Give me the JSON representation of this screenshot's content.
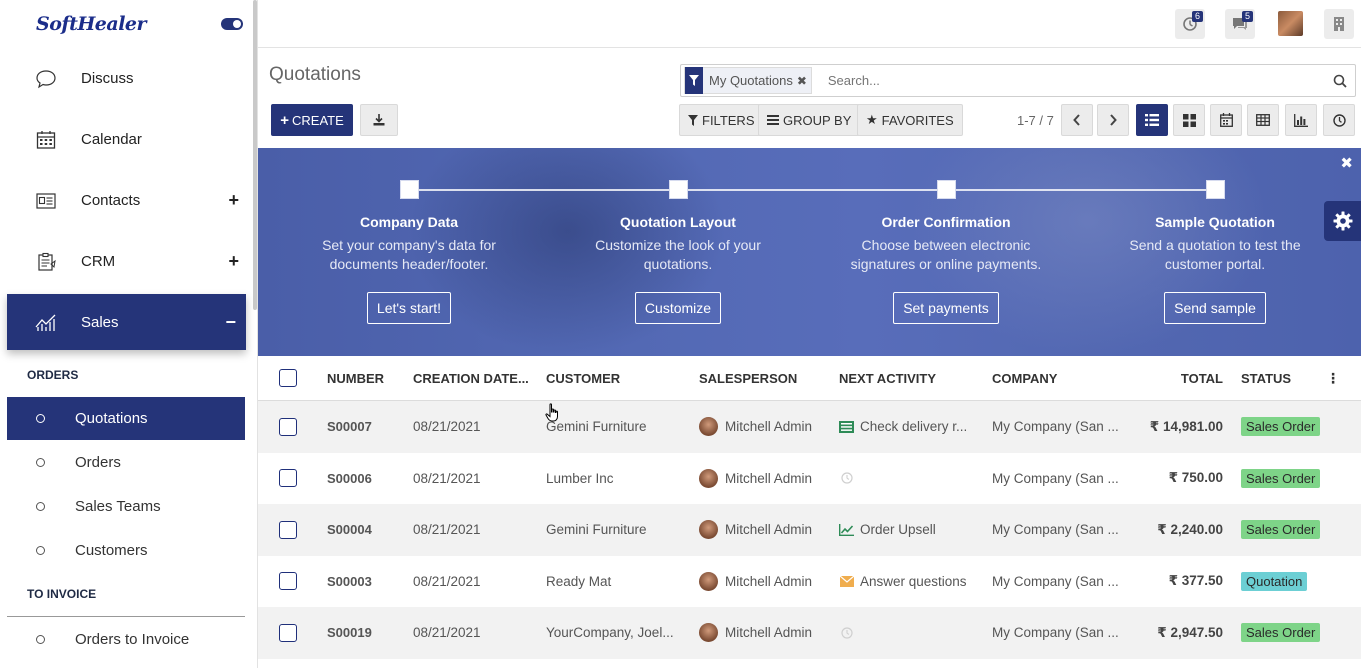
{
  "brand": {
    "logo_text": "SoftHealer"
  },
  "sidebar": {
    "menu": [
      {
        "label": "Discuss",
        "icon": "chat-bubble-icon",
        "expand": ""
      },
      {
        "label": "Calendar",
        "icon": "calendar-icon",
        "expand": ""
      },
      {
        "label": "Contacts",
        "icon": "contacts-card-icon",
        "expand": "+"
      },
      {
        "label": "CRM",
        "icon": "crm-clipboard-icon",
        "expand": "+"
      },
      {
        "label": "Sales",
        "icon": "sales-chart-icon",
        "expand": "−"
      }
    ],
    "section_orders": "ORDERS",
    "orders_items": [
      "Quotations",
      "Orders",
      "Sales Teams",
      "Customers"
    ],
    "section_invoice": "TO INVOICE",
    "invoice_items": [
      "Orders to Invoice"
    ]
  },
  "topbar": {
    "activity_count": "6",
    "messages_count": "5"
  },
  "control": {
    "title": "Quotations",
    "facet_label": "My Quotations",
    "search_placeholder": "Search...",
    "create_label": "CREATE",
    "filters_label": "FILTERS",
    "groupby_label": "GROUP BY",
    "favorites_label": "FAVORITES",
    "pager": "1-7 / 7"
  },
  "banner": {
    "steps": [
      {
        "title": "Company Data",
        "desc1": "Set your company's data for",
        "desc2": "documents header/footer.",
        "button": "Let's start!"
      },
      {
        "title": "Quotation Layout",
        "desc1": "Customize the look of your",
        "desc2": "quotations.",
        "button": "Customize"
      },
      {
        "title": "Order Confirmation",
        "desc1": "Choose between electronic",
        "desc2": "signatures or online payments.",
        "button": "Set payments"
      },
      {
        "title": "Sample Quotation",
        "desc1": "Send a quotation to test the",
        "desc2": "customer portal.",
        "button": "Send sample"
      }
    ]
  },
  "table": {
    "headers": [
      "NUMBER",
      "CREATION DATE...",
      "CUSTOMER",
      "SALESPERSON",
      "NEXT ACTIVITY",
      "COMPANY",
      "TOTAL",
      "STATUS"
    ],
    "rows": [
      {
        "number": "S00007",
        "date": "08/21/2021",
        "customer": "Gemini Furniture",
        "salesperson": "Mitchell Admin",
        "activity": "Check delivery r...",
        "activity_icon": "todo-list-icon",
        "company": "My Company (San ...",
        "total": "₹ 14,981.00",
        "status": "Sales Order",
        "status_color": "#7ed488"
      },
      {
        "number": "S00006",
        "date": "08/21/2021",
        "customer": "Lumber Inc",
        "salesperson": "Mitchell Admin",
        "activity": "",
        "activity_icon": "clock-icon",
        "company": "My Company (San ...",
        "total": "₹ 750.00",
        "status": "Sales Order",
        "status_color": "#7ed488"
      },
      {
        "number": "S00004",
        "date": "08/21/2021",
        "customer": "Gemini Furniture",
        "salesperson": "Mitchell Admin",
        "activity": "Order Upsell",
        "activity_icon": "trend-up-icon",
        "company": "My Company (San ...",
        "total": "₹ 2,240.00",
        "status": "Sales Order",
        "status_color": "#7ed488"
      },
      {
        "number": "S00003",
        "date": "08/21/2021",
        "customer": "Ready Mat",
        "salesperson": "Mitchell Admin",
        "activity": "Answer questions",
        "activity_icon": "envelope-icon",
        "company": "My Company (San ...",
        "total": "₹ 377.50",
        "status": "Quotation",
        "status_color": "#6ccfd4"
      },
      {
        "number": "S00019",
        "date": "08/21/2021",
        "customer": "YourCompany, Joel...",
        "salesperson": "Mitchell Admin",
        "activity": "",
        "activity_icon": "clock-icon",
        "company": "My Company (San ...",
        "total": "₹ 2,947.50",
        "status": "Sales Order",
        "status_color": "#7ed488"
      }
    ]
  },
  "colors": {
    "primary": "#253479",
    "sales_order": "#7ed488",
    "quotation": "#6ccfd4"
  }
}
